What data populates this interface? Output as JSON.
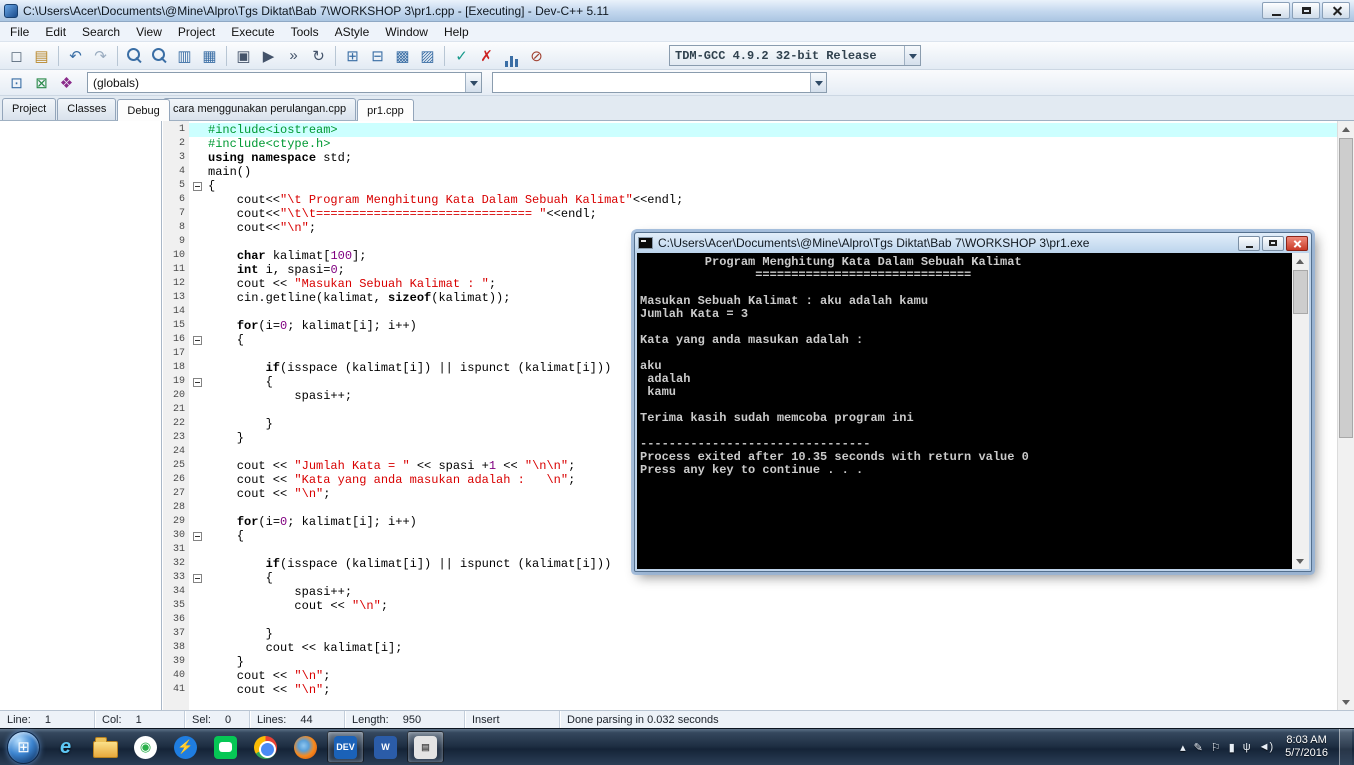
{
  "window": {
    "title": "C:\\Users\\Acer\\Documents\\@Mine\\Alpro\\Tgs Diktat\\Bab 7\\WORKSHOP 3\\pr1.cpp - [Executing] - Dev-C++ 5.11"
  },
  "menu": {
    "items": [
      "File",
      "Edit",
      "Search",
      "View",
      "Project",
      "Execute",
      "Tools",
      "AStyle",
      "Window",
      "Help"
    ]
  },
  "toolbar": {
    "compiler_profile": "TDM-GCC 4.9.2 32-bit Release",
    "main_icons": [
      {
        "name": "new-file-icon",
        "g": "◻",
        "c": "#5a6b7c"
      },
      {
        "name": "open-file-icon",
        "g": "▤",
        "c": "#b8872a"
      },
      {
        "sep": true
      },
      {
        "name": "undo-icon",
        "g": "↶",
        "c": "#3a6ea5"
      },
      {
        "name": "redo-icon",
        "g": "↷",
        "c": "#9aacc0"
      },
      {
        "sep": true
      },
      {
        "name": "find-icon",
        "cls": "mag"
      },
      {
        "name": "replace-icon",
        "cls": "mag"
      },
      {
        "name": "find-in-files-icon",
        "g": "▥",
        "c": "#3a6ea5"
      },
      {
        "name": "goto-line-icon",
        "g": "▦",
        "c": "#3a6ea5"
      },
      {
        "sep": true
      },
      {
        "name": "compile-icon",
        "g": "▣",
        "c": "#44536a"
      },
      {
        "name": "run-icon",
        "g": "▶",
        "c": "#44536a"
      },
      {
        "name": "compile-run-icon",
        "g": "»",
        "c": "#44536a"
      },
      {
        "name": "rebuild-all-icon",
        "g": "↻",
        "c": "#44536a"
      },
      {
        "sep": true
      },
      {
        "name": "project-new-icon",
        "g": "⊞",
        "c": "#3a6ea5"
      },
      {
        "name": "window-tile-icon",
        "g": "⊟",
        "c": "#3a6ea5"
      },
      {
        "name": "window-cascade-icon",
        "g": "▩",
        "c": "#3a6ea5"
      },
      {
        "name": "window-layout-icon",
        "g": "▨",
        "c": "#3a6ea5"
      },
      {
        "sep": true
      },
      {
        "name": "syntax-check-icon",
        "g": "✓",
        "c": "#199a8c"
      },
      {
        "name": "abort-compile-icon",
        "g": "✗",
        "c": "#cc2222"
      },
      {
        "name": "profile-analysis-icon",
        "cls": "chart"
      },
      {
        "name": "delete-profiling-icon",
        "g": "⊘",
        "c": "#a04030"
      }
    ],
    "row2_icons": [
      {
        "name": "view-project-icon",
        "g": "⊡",
        "c": "#3a6ea5"
      },
      {
        "name": "view-classes-icon",
        "g": "⊠",
        "c": "#2a8a4a"
      },
      {
        "name": "class-browser-icon",
        "g": "❖",
        "c": "#8a2a8a"
      }
    ]
  },
  "nav": {
    "globals_value": "(globals)",
    "members_value": ""
  },
  "left_panel": {
    "tabs": [
      {
        "label": "Project",
        "active": false
      },
      {
        "label": "Classes",
        "active": false
      },
      {
        "label": "Debug",
        "active": true
      }
    ]
  },
  "editor": {
    "tabs": [
      {
        "label": "cara menggunakan perulangan.cpp",
        "active": false
      },
      {
        "label": "pr1.cpp",
        "active": true
      }
    ],
    "lines": [
      {
        "n": 1,
        "cur": true,
        "t": [
          [
            "i",
            "#include<iostream>"
          ]
        ]
      },
      {
        "n": 2,
        "t": [
          [
            "i",
            "#include<ctype.h>"
          ]
        ]
      },
      {
        "n": 3,
        "t": [
          [
            "k",
            "using"
          ],
          [
            "p",
            " "
          ],
          [
            "k",
            "namespace"
          ],
          [
            "p",
            " std;"
          ]
        ]
      },
      {
        "n": 4,
        "t": [
          [
            "p",
            "main()"
          ]
        ]
      },
      {
        "n": 5,
        "fold": true,
        "t": [
          [
            "p",
            "{"
          ]
        ]
      },
      {
        "n": 6,
        "t": [
          [
            "p",
            "    cout<<"
          ],
          [
            "s",
            "\"\\t Program Menghitung Kata Dalam Sebuah Kalimat\""
          ],
          [
            "p",
            "<<endl;"
          ]
        ]
      },
      {
        "n": 7,
        "t": [
          [
            "p",
            "    cout<<"
          ],
          [
            "s",
            "\"\\t\\t============================== \""
          ],
          [
            "p",
            "<<endl;"
          ]
        ]
      },
      {
        "n": 8,
        "t": [
          [
            "p",
            "    cout<<"
          ],
          [
            "s",
            "\"\\n\""
          ],
          [
            "p",
            ";"
          ]
        ]
      },
      {
        "n": 9,
        "t": []
      },
      {
        "n": 10,
        "t": [
          [
            "p",
            "    "
          ],
          [
            "k",
            "char"
          ],
          [
            "p",
            " kalimat["
          ],
          [
            "n",
            "100"
          ],
          [
            "p",
            "];"
          ]
        ]
      },
      {
        "n": 11,
        "t": [
          [
            "p",
            "    "
          ],
          [
            "k",
            "int"
          ],
          [
            "p",
            " i, spasi="
          ],
          [
            "n",
            "0"
          ],
          [
            "p",
            ";"
          ]
        ]
      },
      {
        "n": 12,
        "t": [
          [
            "p",
            "    cout << "
          ],
          [
            "s",
            "\"Masukan Sebuah Kalimat : \""
          ],
          [
            "p",
            ";"
          ]
        ]
      },
      {
        "n": 13,
        "t": [
          [
            "p",
            "    cin.getline(kalimat, "
          ],
          [
            "k",
            "sizeof"
          ],
          [
            "p",
            "(kalimat));"
          ]
        ]
      },
      {
        "n": 14,
        "t": []
      },
      {
        "n": 15,
        "t": [
          [
            "p",
            "    "
          ],
          [
            "k",
            "for"
          ],
          [
            "p",
            "(i="
          ],
          [
            "n",
            "0"
          ],
          [
            "p",
            "; kalimat[i]; i++)"
          ]
        ]
      },
      {
        "n": 16,
        "fold": true,
        "t": [
          [
            "p",
            "    {"
          ]
        ]
      },
      {
        "n": 17,
        "t": []
      },
      {
        "n": 18,
        "t": [
          [
            "p",
            "        "
          ],
          [
            "k",
            "if"
          ],
          [
            "p",
            "(isspace (kalimat[i]) || ispunct (kalimat[i]))"
          ]
        ]
      },
      {
        "n": 19,
        "fold": true,
        "t": [
          [
            "p",
            "        {"
          ]
        ]
      },
      {
        "n": 20,
        "t": [
          [
            "p",
            "            spasi++;"
          ]
        ]
      },
      {
        "n": 21,
        "t": []
      },
      {
        "n": 22,
        "t": [
          [
            "p",
            "        }"
          ]
        ]
      },
      {
        "n": 23,
        "t": [
          [
            "p",
            "    }"
          ]
        ]
      },
      {
        "n": 24,
        "t": []
      },
      {
        "n": 25,
        "t": [
          [
            "p",
            "    cout << "
          ],
          [
            "s",
            "\"Jumlah Kata = \""
          ],
          [
            "p",
            " << spasi +"
          ],
          [
            "n",
            "1"
          ],
          [
            "p",
            " << "
          ],
          [
            "s",
            "\"\\n\\n\""
          ],
          [
            "p",
            ";"
          ]
        ]
      },
      {
        "n": 26,
        "t": [
          [
            "p",
            "    cout << "
          ],
          [
            "s",
            "\"Kata yang anda masukan adalah :   \\n\""
          ],
          [
            "p",
            ";"
          ]
        ]
      },
      {
        "n": 27,
        "t": [
          [
            "p",
            "    cout << "
          ],
          [
            "s",
            "\"\\n\""
          ],
          [
            "p",
            ";"
          ]
        ]
      },
      {
        "n": 28,
        "t": []
      },
      {
        "n": 29,
        "t": [
          [
            "p",
            "    "
          ],
          [
            "k",
            "for"
          ],
          [
            "p",
            "(i="
          ],
          [
            "n",
            "0"
          ],
          [
            "p",
            "; kalimat[i]; i++)"
          ]
        ]
      },
      {
        "n": 30,
        "fold": true,
        "t": [
          [
            "p",
            "    {"
          ]
        ]
      },
      {
        "n": 31,
        "t": []
      },
      {
        "n": 32,
        "t": [
          [
            "p",
            "        "
          ],
          [
            "k",
            "if"
          ],
          [
            "p",
            "(isspace (kalimat[i]) || ispunct (kalimat[i]))"
          ]
        ]
      },
      {
        "n": 33,
        "fold": true,
        "t": [
          [
            "p",
            "        {"
          ]
        ]
      },
      {
        "n": 34,
        "t": [
          [
            "p",
            "            spasi++;"
          ]
        ]
      },
      {
        "n": 35,
        "t": [
          [
            "p",
            "            cout << "
          ],
          [
            "s",
            "\"\\n\""
          ],
          [
            "p",
            ";"
          ]
        ]
      },
      {
        "n": 36,
        "t": []
      },
      {
        "n": 37,
        "t": [
          [
            "p",
            "        }"
          ]
        ]
      },
      {
        "n": 38,
        "t": [
          [
            "p",
            "        cout << kalimat[i];"
          ]
        ]
      },
      {
        "n": 39,
        "t": [
          [
            "p",
            "    }"
          ]
        ]
      },
      {
        "n": 40,
        "t": [
          [
            "p",
            "    cout << "
          ],
          [
            "s",
            "\"\\n\""
          ],
          [
            "p",
            ";"
          ]
        ]
      },
      {
        "n": 41,
        "t": [
          [
            "p",
            "    cout << "
          ],
          [
            "s",
            "\"\\n\""
          ],
          [
            "p",
            ";"
          ]
        ]
      }
    ]
  },
  "console": {
    "title": "C:\\Users\\Acer\\Documents\\@Mine\\Alpro\\Tgs Diktat\\Bab 7\\WORKSHOP 3\\pr1.exe",
    "lines": [
      "         Program Menghitung Kata Dalam Sebuah Kalimat",
      "                ============================== ",
      "",
      "Masukan Sebuah Kalimat : aku adalah kamu",
      "Jumlah Kata = 3",
      "",
      "Kata yang anda masukan adalah :",
      "",
      "aku",
      " adalah",
      " kamu",
      "",
      "Terima kasih sudah memcoba program ini",
      "",
      "--------------------------------",
      "Process exited after 10.35 seconds with return value 0",
      "Press any key to continue . . ."
    ]
  },
  "status": {
    "segments": [
      {
        "label": "Line:",
        "value": "1",
        "w": 95
      },
      {
        "label": "Col:",
        "value": "1",
        "w": 90
      },
      {
        "label": "Sel:",
        "value": "0",
        "w": 65
      },
      {
        "label": "Lines:",
        "value": "44",
        "w": 95
      },
      {
        "label": "Length:",
        "value": "950",
        "w": 120
      },
      {
        "label": "",
        "value": "Insert",
        "w": 95
      },
      {
        "label": "",
        "value": "Done parsing in 0.032 seconds",
        "w": 0
      }
    ]
  },
  "taskbar": {
    "start_glyph": "⊞",
    "items": [
      {
        "name": "taskbar-internet-explorer",
        "cls": "plain",
        "g": "e",
        "fg": "#5ec8f5"
      },
      {
        "name": "taskbar-file-explorer",
        "cls": "folder-icon"
      },
      {
        "name": "taskbar-green-app",
        "cls": "circle",
        "bg": "#ffffff",
        "g": "◉",
        "fg": "#2ab04a"
      },
      {
        "name": "taskbar-messenger",
        "cls": "circle",
        "bg": "#1f7de0",
        "g": "⚡",
        "fg": "#ffffff"
      },
      {
        "name": "taskbar-line",
        "cls": "tile line-tile",
        "bg": "#06c755"
      },
      {
        "name": "taskbar-chrome",
        "cls": "chrome-icon"
      },
      {
        "name": "taskbar-firefox",
        "cls": "firefox-icon"
      },
      {
        "name": "taskbar-devcpp",
        "cls": "tile",
        "bg": "#1b62b8",
        "g": "DEV",
        "fg": "#ffffff",
        "active": true
      },
      {
        "name": "taskbar-word",
        "cls": "tile",
        "bg": "#2b5ca8",
        "g": "W",
        "fg": "#ffffff"
      },
      {
        "name": "taskbar-pr1-console",
        "cls": "tile",
        "bg": "#e4e4e4",
        "g": "▤",
        "fg": "#555555",
        "active": true
      }
    ],
    "tray": [
      {
        "name": "hidden-icons-arrow",
        "g": "▴"
      },
      {
        "name": "pen-input-icon",
        "g": "✎"
      },
      {
        "name": "action-center-flag-icon",
        "g": "⚐"
      },
      {
        "name": "battery-icon",
        "g": "▮"
      },
      {
        "name": "usb-device-icon",
        "g": "ψ"
      },
      {
        "name": "volume-icon",
        "g": "◄)"
      }
    ],
    "clock": {
      "time": "8:03 AM",
      "date": "5/7/2016"
    }
  }
}
